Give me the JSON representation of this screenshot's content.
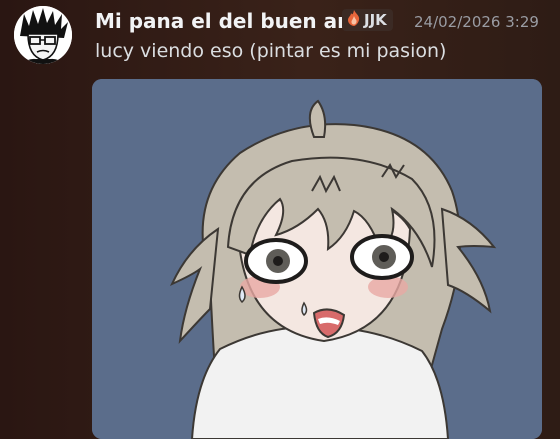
{
  "message": {
    "author": "Mi pana el del buen arte",
    "clan_tag": {
      "icon": "flame-icon",
      "text": "JJK"
    },
    "timestamp": "24/02/2026 3:29",
    "content": "lucy viendo eso (pintar es mi pasion)",
    "attachment": {
      "type": "image",
      "subject": "anime-girl-drawing"
    }
  },
  "colors": {
    "background": "#2e1a14",
    "username": "#f2f3f5",
    "message_text": "#dbdee1",
    "timestamp": "#9a9ca3",
    "attachment_bg": "#5b6d8b",
    "hair": "#c7c0b2",
    "shirt": "#f2f2f2"
  }
}
